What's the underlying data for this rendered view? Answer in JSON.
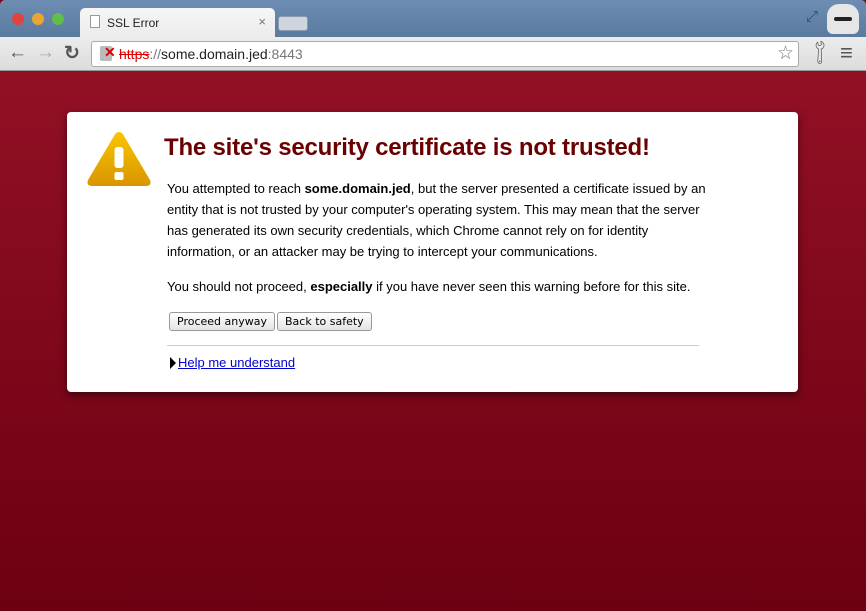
{
  "window": {
    "tab_title": "SSL Error",
    "tab_close": "×"
  },
  "toolbar": {
    "url_scheme": "https",
    "url_sep": "://",
    "url_host": "some.domain.jed",
    "url_port": ":8443",
    "back": "←",
    "forward": "→",
    "reload": "↻",
    "bookmark": "☆",
    "menu": "≡"
  },
  "page": {
    "title": "The site's security certificate is not trusted!",
    "p1_a": "You attempted to reach ",
    "p1_host": "some.domain.jed",
    "p1_b": ", but the server presented a certificate issued by an entity that is not trusted by your computer's operating system. This may mean that the server has generated its own security credentials, which Chrome cannot rely on for identity information, or an attacker may be trying to intercept your communications.",
    "p2_a": "You should not proceed, ",
    "p2_b": "especially",
    "p2_c": " if you have never seen this warning before for this site.",
    "proceed": "Proceed anyway",
    "back_to_safety": "Back to safety",
    "help": "Help me understand"
  },
  "colors": {
    "background": "#7a0a18",
    "title": "#6b0000",
    "link": "#0000cc"
  }
}
